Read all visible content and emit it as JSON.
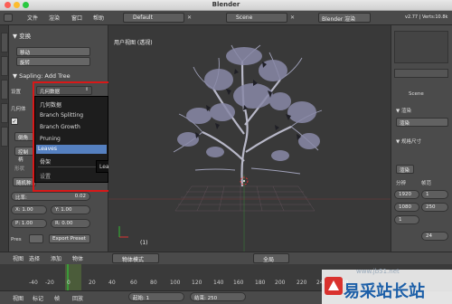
{
  "window": {
    "title": "Blender"
  },
  "topbar": {
    "menus": [
      "文件",
      "渲染",
      "窗口",
      "帮助"
    ],
    "layout_field": "Default",
    "scene_field": "Scene",
    "engine_field": "Blender 渲染",
    "version_info": "v2.77 | Verts:10.8k"
  },
  "left_panel": {
    "transform_header": "▼ 变换",
    "move_button": "移动",
    "rotate_button": "旋转",
    "addon_header": "▼ Sapling: Add Tree",
    "settings_label": "设置",
    "settings_value": "几何数据",
    "geometry_label": "几何体",
    "row_labels": [
      "倒角",
      "控制柄",
      "形状",
      "随机种"
    ],
    "ratio_label": "比率:",
    "ratio_value": "0.02",
    "scale_label": "1.00",
    "row1": [
      "X: 1.00",
      "Y: 1.00"
    ],
    "row2": [
      "1.00",
      "0.00"
    ],
    "row3": [
      "P: 1.00",
      "R: 0.00"
    ],
    "pres_label": "Pres",
    "export_button": "Export Preset"
  },
  "popup": {
    "items": [
      "几何数据",
      "Branch Splitting",
      "Branch Growth",
      "Pruning",
      "Leaves",
      "骨架",
      "设置"
    ],
    "selected_index": 4,
    "tooltip": "Leaves"
  },
  "viewport": {
    "title": "用户视图 (透视)",
    "frame_counter": "(1)"
  },
  "right_panel": {
    "scene_label": "Scene",
    "render_header": "▼ 渲染",
    "render_button": "渲染",
    "size_header": "▼ 规格尺寸",
    "preset_button": "渲染",
    "resolution_label": "分辨",
    "frames_label": "帧范",
    "values": [
      "1920",
      "1080",
      "1",
      "250",
      "1",
      "24"
    ]
  },
  "bottom_bar": {
    "items": [
      "视图",
      "选择",
      "添加",
      "物体",
      "物体模式",
      "全局"
    ]
  },
  "timeline": {
    "ticks": [
      "-40",
      "-20",
      "0",
      "20",
      "40",
      "60",
      "80",
      "100",
      "120",
      "140",
      "160",
      "180",
      "200",
      "220",
      "240",
      "260"
    ],
    "bar_items": [
      "视图",
      "标记",
      "帧",
      "回放"
    ],
    "start_label": "起始:",
    "start_value": "1",
    "end_label": "结束:",
    "end_value": "250"
  },
  "watermark": {
    "brand": "易采站长站",
    "url": "www.jb51.net"
  },
  "colors": {
    "selection": "#5580c0",
    "highlight_box": "#d81818",
    "watermark": "#1c5fa8"
  }
}
